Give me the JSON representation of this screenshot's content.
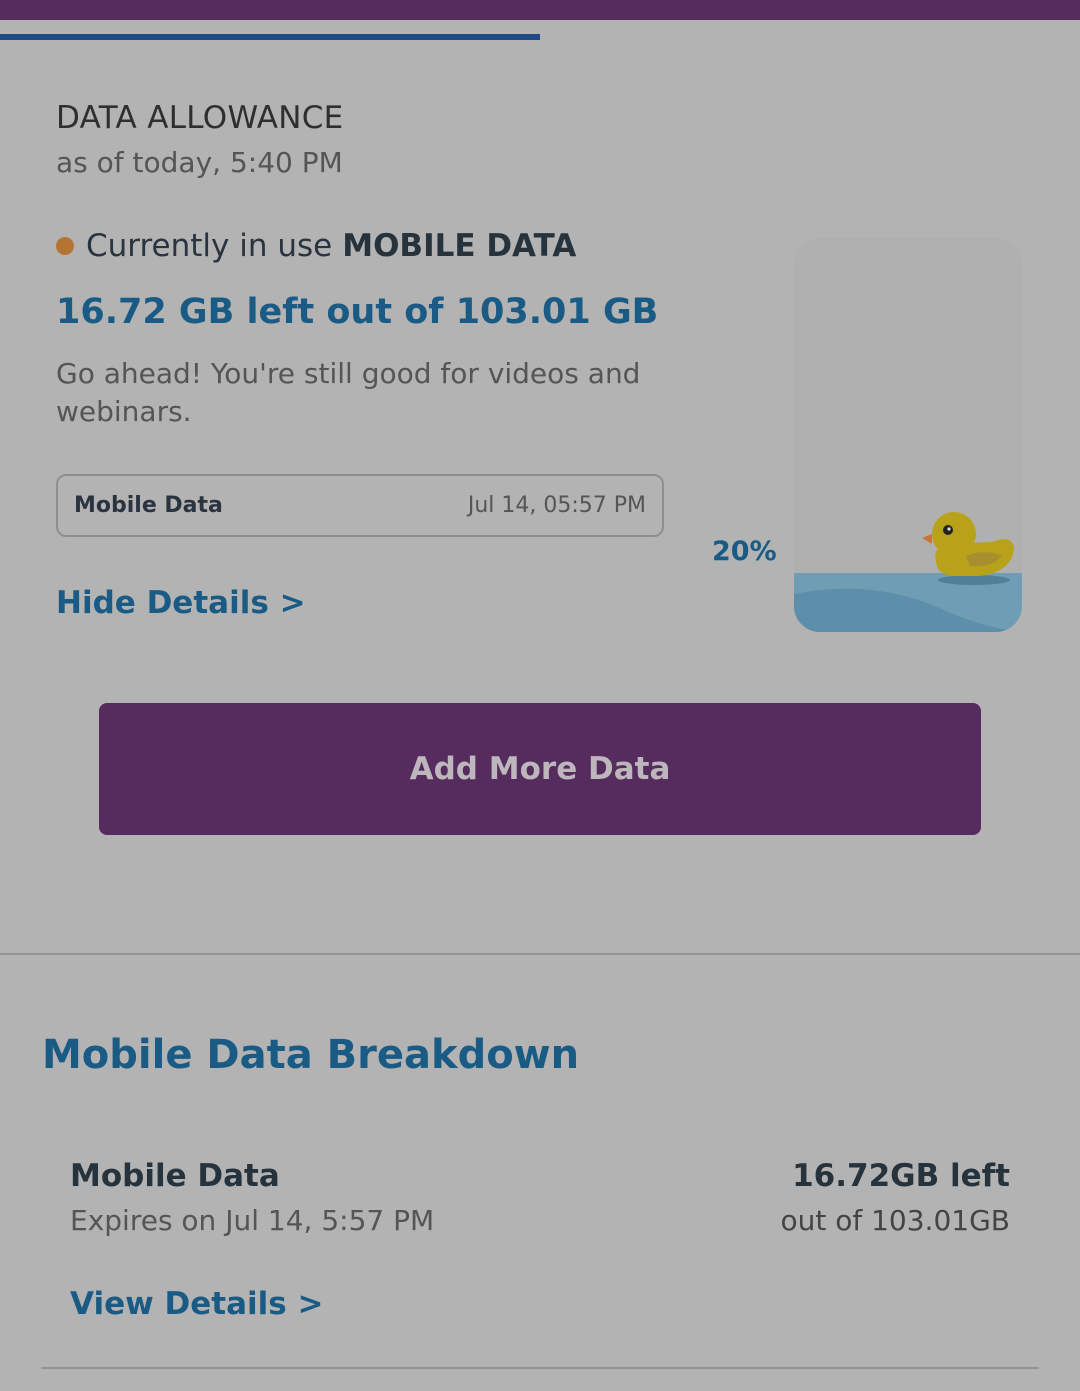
{
  "progress": {
    "fraction": 0.5,
    "color": "#1e4a8a"
  },
  "allowance": {
    "title": "DATA ALLOWANCE",
    "as_of": "as of today, 5:40 PM",
    "in_use_prefix": "Currently in use",
    "in_use_type": "MOBILE DATA",
    "status_dot_color": "#b57432",
    "amount_text": "16.72 GB left out of 103.01 GB",
    "message": "Go ahead! You're still good for videos and webinars.",
    "detail_box": {
      "name": "Mobile Data",
      "date": "Jul 14, 05:57 PM"
    },
    "hide_details": "Hide Details >",
    "percent_label": "20%",
    "tank_fill_fraction": 0.2,
    "tank_icon": "rubber-duck-icon"
  },
  "add_more_button": "Add More Data",
  "breakdown": {
    "title": "Mobile Data Breakdown",
    "items": [
      {
        "name": "Mobile Data",
        "expires": "Expires on Jul 14, 5:57 PM",
        "left": "16.72GB left",
        "out_of": "out of 103.01GB",
        "view_details": "View Details >"
      }
    ]
  },
  "colors": {
    "brand_purple": "#562b5d",
    "link_blue": "#1a5b85",
    "overlay_gray": "#b3b3b3"
  }
}
